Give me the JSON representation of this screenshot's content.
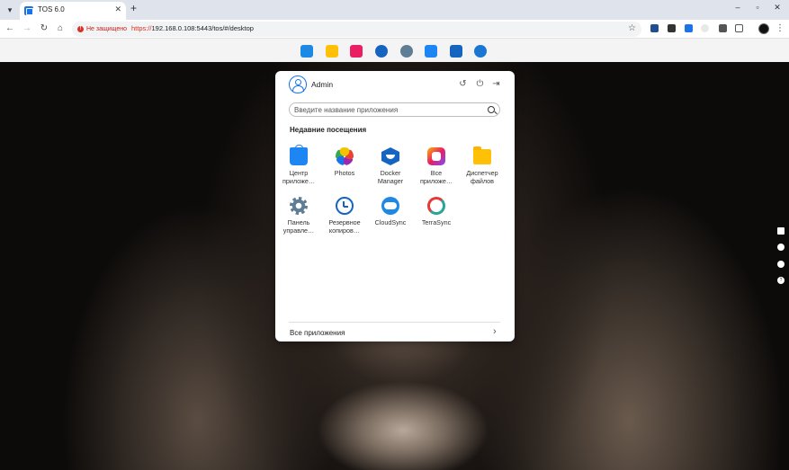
{
  "browser": {
    "tab_title": "TOS 6.0",
    "tab_close": "✕",
    "new_tab": "+",
    "insecure_label": "Не защищено",
    "url_scheme": "https://",
    "url_rest": "192.168.0.108:5443/tos/#/desktop",
    "window_controls": [
      "–",
      "▫",
      "✕"
    ]
  },
  "dock": {
    "icons": [
      {
        "name": "control-panel-icon",
        "color": "#1e88e5"
      },
      {
        "name": "file-manager-icon",
        "color": "#ffc107"
      },
      {
        "name": "all-apps-icon",
        "color": "#e91e63"
      },
      {
        "name": "backup-icon",
        "color": "#1565c0"
      },
      {
        "name": "settings-icon",
        "color": "#5f7d95"
      },
      {
        "name": "app-center-icon",
        "color": "#1e86f2"
      },
      {
        "name": "docker-icon",
        "color": "#1565c0"
      },
      {
        "name": "support-icon",
        "color": "#1976d2"
      }
    ]
  },
  "menu": {
    "user_name": "Admin",
    "search_placeholder": "Введите название приложения",
    "recent_title": "Недавние посещения",
    "apps": [
      {
        "label": "Центр\nприложе…",
        "icon": "app-center-icon"
      },
      {
        "label": "Photos",
        "icon": "photos-icon"
      },
      {
        "label": "Docker\nManager",
        "icon": "docker-icon"
      },
      {
        "label": "Все\nприложе…",
        "icon": "all-apps-icon"
      },
      {
        "label": "Диспетчер\nфайлов",
        "icon": "file-manager-icon"
      },
      {
        "label": "Панель\nуправле…",
        "icon": "settings-icon"
      },
      {
        "label": "Резервное\nкопиров…",
        "icon": "backup-icon"
      },
      {
        "label": "CloudSync",
        "icon": "cloudsync-icon"
      },
      {
        "label": "TerraSync",
        "icon": "terrasync-icon"
      }
    ],
    "all_apps_label": "Все приложения",
    "all_apps_chevron": "›"
  },
  "colors": {
    "accent": "#1a73e8",
    "insecure": "#d93025"
  }
}
